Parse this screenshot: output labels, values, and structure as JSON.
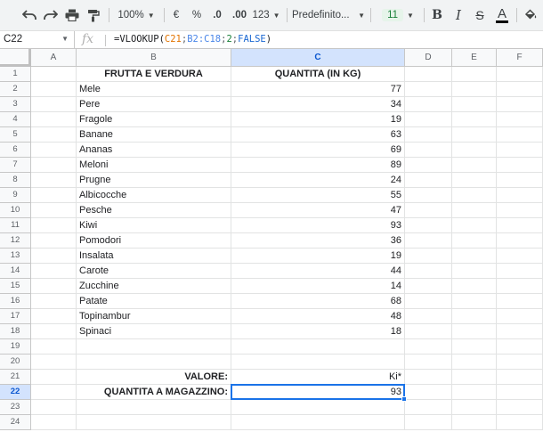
{
  "toolbar": {
    "zoom": "100%",
    "currency": "€",
    "percent": "%",
    "decrease_decimals": ".0",
    "increase_decimals": ".00",
    "more_formats": "123",
    "font": "Predefinito...",
    "font_size": "11",
    "bold": "B",
    "italic": "I",
    "strikethrough": "S",
    "text_color": "A",
    "icons": [
      "undo-icon",
      "redo-icon",
      "print-icon",
      "paint-format-icon",
      "fill-color-icon"
    ]
  },
  "formula_bar": {
    "name_box": "C22",
    "fx": "fx",
    "formula": {
      "fn": "=VLOOKUP(",
      "ref1": "C21",
      "sep1": ";",
      "ref2": "B2:C18",
      "sep2": ";",
      "num": "2",
      "sep3": ";",
      "bool": "FALSE",
      "close": ")"
    }
  },
  "columns": [
    "A",
    "B",
    "C",
    "D",
    "E",
    "F"
  ],
  "rows": [
    "1",
    "2",
    "3",
    "4",
    "5",
    "6",
    "7",
    "8",
    "9",
    "10",
    "11",
    "12",
    "13",
    "14",
    "15",
    "16",
    "17",
    "18",
    "19",
    "20",
    "21",
    "22",
    "23",
    "24"
  ],
  "sheet": {
    "header": {
      "b": "FRUTTA E VERDURA",
      "c": "QUANTITA (IN KG)"
    },
    "items": [
      {
        "name": "Mele",
        "qty": "77"
      },
      {
        "name": "Pere",
        "qty": "34"
      },
      {
        "name": "Fragole",
        "qty": "19"
      },
      {
        "name": "Banane",
        "qty": "63"
      },
      {
        "name": "Ananas",
        "qty": "69"
      },
      {
        "name": "Meloni",
        "qty": "89"
      },
      {
        "name": "Prugne",
        "qty": "24"
      },
      {
        "name": "Albicocche",
        "qty": "55"
      },
      {
        "name": "Pesche",
        "qty": "47"
      },
      {
        "name": "Kiwi",
        "qty": "93"
      },
      {
        "name": "Pomodori",
        "qty": "36"
      },
      {
        "name": "Insalata",
        "qty": "19"
      },
      {
        "name": "Carote",
        "qty": "44"
      },
      {
        "name": "Zucchine",
        "qty": "14"
      },
      {
        "name": "Patate",
        "qty": "68"
      },
      {
        "name": "Topinambur",
        "qty": "48"
      },
      {
        "name": "Spinaci",
        "qty": "18"
      }
    ],
    "lookup_label": "VALORE:",
    "lookup_value": "Ki*",
    "result_label": "QUANTITA A MAGAZZINO:",
    "result_value": "93"
  },
  "selected_cell": "C22"
}
